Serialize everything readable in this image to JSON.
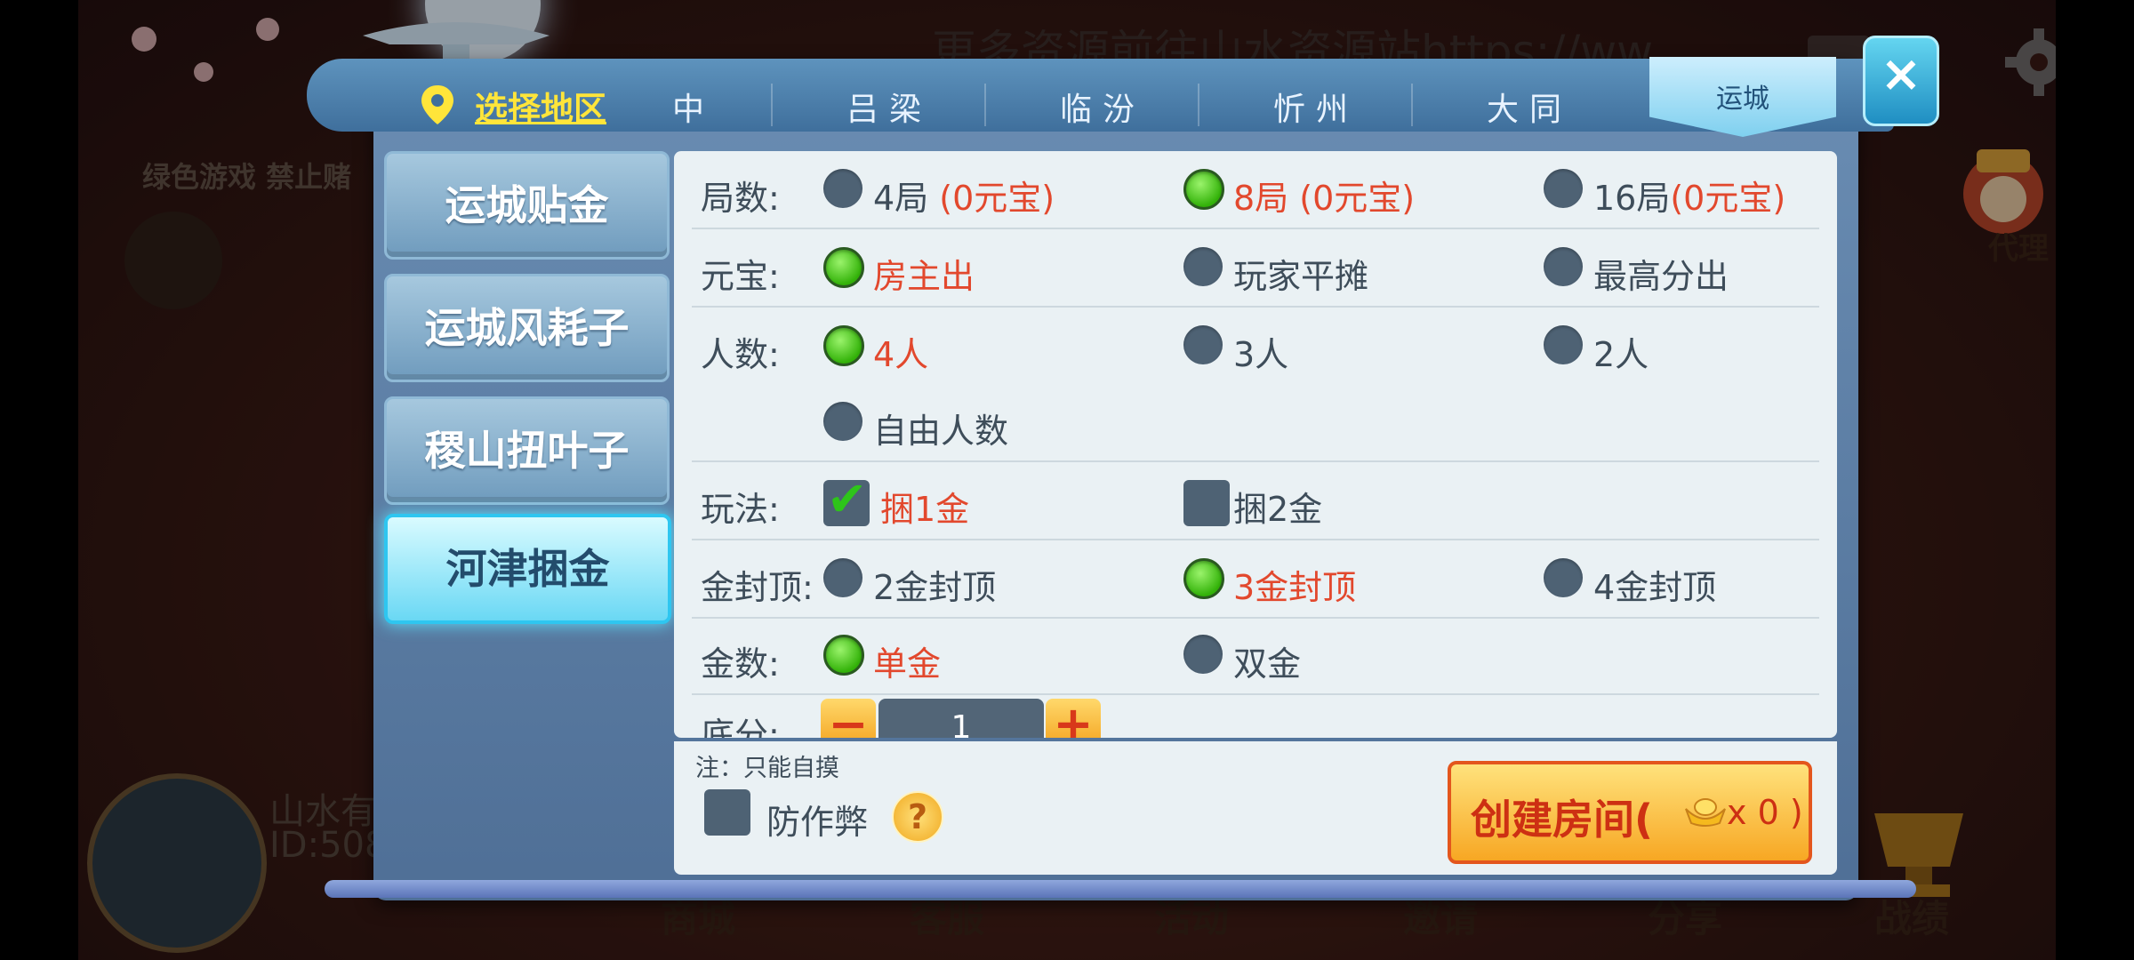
{
  "background": {
    "notice": "绿色游戏 禁止赌",
    "top_text": "更多资源前往山水资源站https://ww",
    "player_name": "山水有",
    "player_id": "ID:508",
    "agent_label": "代理",
    "bottom_nav": [
      "商城",
      "客服",
      "活动",
      "邀请",
      "分享",
      "战绩"
    ]
  },
  "header": {
    "region_select": "选择地区",
    "cities": [
      "中",
      "吕梁",
      "临汾",
      "忻州",
      "大同"
    ],
    "active_city": "运城"
  },
  "close_label": "×",
  "games": [
    {
      "label": "运城贴金",
      "active": false
    },
    {
      "label": "运城风耗子",
      "active": false
    },
    {
      "label": "稷山扭叶子",
      "active": false
    },
    {
      "label": "河津捆金",
      "active": true
    }
  ],
  "options": {
    "rounds": {
      "label": "局数:",
      "items": [
        {
          "main": "4局",
          "sub": "(0元宝)",
          "selected": false
        },
        {
          "main": "8局",
          "sub": "(0元宝)",
          "selected": true
        },
        {
          "main": "16局",
          "sub": "(0元宝)",
          "selected": false
        }
      ]
    },
    "ingot": {
      "label": "元宝:",
      "items": [
        {
          "main": "房主出",
          "selected": true
        },
        {
          "main": "玩家平摊",
          "selected": false
        },
        {
          "main": "最高分出",
          "selected": false
        }
      ]
    },
    "players": {
      "label": "人数:",
      "items": [
        {
          "main": "4人",
          "selected": true
        },
        {
          "main": "3人",
          "selected": false
        },
        {
          "main": "2人",
          "selected": false
        },
        {
          "main": "自由人数",
          "selected": false
        }
      ]
    },
    "play": {
      "label": "玩法:",
      "items": [
        {
          "main": "捆1金",
          "checked": true
        },
        {
          "main": "捆2金",
          "checked": false
        }
      ]
    },
    "cap": {
      "label": "金封顶:",
      "items": [
        {
          "main": "2金封顶",
          "selected": false
        },
        {
          "main": "3金封顶",
          "selected": true
        },
        {
          "main": "4金封顶",
          "selected": false
        }
      ]
    },
    "gold_count": {
      "label": "金数:",
      "items": [
        {
          "main": "单金",
          "selected": true
        },
        {
          "main": "双金",
          "selected": false
        }
      ]
    },
    "base_score": {
      "label": "底分:",
      "minus": "−",
      "value": "1",
      "plus": "+"
    }
  },
  "footer": {
    "note": "注：只能自摸",
    "anti_cheat": "防作弊",
    "help": "?",
    "create_room": "创建房间(",
    "create_cost": "x 0 )"
  },
  "colors": {
    "selected_text": "#e2482d",
    "option_text": "#3e4d5a",
    "radio_on": "#34b30a",
    "radio_off": "#4e6274"
  }
}
